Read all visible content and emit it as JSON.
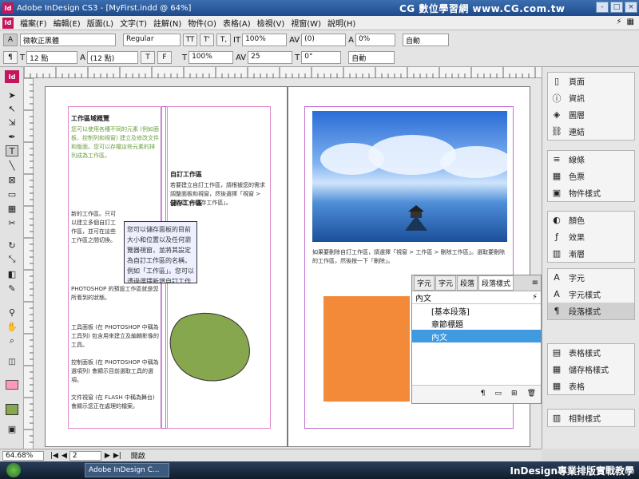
{
  "titlebar": {
    "title": "Adobe InDesign CS3 - [MyFirst.indd @ 64%]",
    "logo": "Id",
    "watermark": "CG 數位學習網 www.CG.com.tw",
    "controls": [
      "-",
      "□",
      "×"
    ]
  },
  "menubar": {
    "logo": "Id",
    "items": [
      "檔案(F)",
      "編輯(E)",
      "版面(L)",
      "文字(T)",
      "註解(N)",
      "物件(O)",
      "表格(A)",
      "檢視(V)",
      "視窗(W)",
      "說明(H)"
    ]
  },
  "control_panel": {
    "row1": {
      "font_family": "微軟正黑體",
      "font_style": "Regular",
      "buttons": [
        "TT",
        "T'",
        "T,",
        "T",
        "Tr",
        "T"
      ],
      "vertical_scale": "100%",
      "kerning": "(0)",
      "baseline_shift": "0%",
      "language": "自動"
    },
    "row2": {
      "font_size": "12 點",
      "leading": "(12 點)",
      "buttons": [
        "T",
        "F",
        "T"
      ],
      "horizontal_scale": "100%",
      "tracking": "25",
      "skew": "0°",
      "rotation": "自動"
    }
  },
  "toolbar": {
    "logo": "Id",
    "tools": [
      "selection",
      "direct-selection",
      "position",
      "pen",
      "type",
      "line",
      "frame",
      "rectangle",
      "table",
      "scissors",
      "rotate",
      "scale",
      "gradient",
      "note",
      "eyedropper",
      "hand",
      "zoom",
      "fill-stroke",
      "apply-color",
      "view-mode"
    ]
  },
  "left_page": {
    "heading": "工作區域概覽",
    "paragraphs": [
      "您可以使用各種不同的元素 (例如面板、控制列和視窗) 建立及修改文件和版面。您可以存檔這些元素的排列成為工作區。",
      "新的工作區。只可以建立多個自訂工作區，並可在這些工作區之間切換。",
      "自訂工作區",
      "若要建立自訂工作區，請根據您的需求調整面板和視窗，然後選擇「視窗 > 工作區 > 儲存工作區」。",
      "儲存工作區",
      "PHOTOSHOP 的預設工作區就是您所看到的狀態。",
      "工具面板 (在 PHOTOSHOP 中稱為工具列) 包含用來建立及編輯影像的工具。",
      "控制面板 (在 PHOTOSHOP 中稱為選項列) 會顯示目前選取工具的選項。",
      "文件視窗 (在 FLASH 中稱為舞台) 會顯示您正在處理的檔案。"
    ],
    "callout": "您可以儲存面板的目前大小和位置以及任何瀏覽器視窗，並將其設定為自訂工作區的名稱，例如「工作區」。您可以透過選擇新增自訂工作區，編輯名稱。"
  },
  "right_page": {
    "caption": "如果要刪除自訂工作區，請選擇「視窗 > 工作區 > 刪除工作區」。選取要刪除的工作區，然後按一下「刪除」。"
  },
  "docked_panels": {
    "group1": [
      {
        "icon": "page-icon",
        "label": "頁面"
      },
      {
        "icon": "info-icon",
        "label": "資訊"
      },
      {
        "icon": "layers-icon",
        "label": "圖層"
      },
      {
        "icon": "link-icon",
        "label": "連結"
      }
    ],
    "group2": [
      {
        "icon": "stroke-icon",
        "label": "線條"
      },
      {
        "icon": "swatch-icon",
        "label": "色票"
      },
      {
        "icon": "object-style-icon",
        "label": "物件樣式"
      }
    ],
    "group3": [
      {
        "icon": "color-icon",
        "label": "顏色"
      },
      {
        "icon": "effects-icon",
        "label": "效果"
      },
      {
        "icon": "gradient-icon",
        "label": "漸層"
      }
    ],
    "group4": [
      {
        "icon": "character-icon",
        "label": "字元"
      },
      {
        "icon": "character-style-icon",
        "label": "字元樣式"
      },
      {
        "icon": "paragraph-style-icon",
        "label": "段落樣式"
      }
    ],
    "group5": [
      {
        "icon": "table-style-icon",
        "label": "表格樣式"
      },
      {
        "icon": "cell-style-icon",
        "label": "儲存格樣式"
      },
      {
        "icon": "table-icon",
        "label": "表格"
      }
    ],
    "group6": [
      {
        "icon": "align-style-icon",
        "label": "相對樣式"
      }
    ]
  },
  "floating_panel": {
    "tabs": [
      "字元",
      "字元",
      "段落",
      "段落樣式"
    ],
    "header": "內文",
    "items": [
      "[基本段落]",
      "章節標題",
      "內文"
    ],
    "selected_index": 2
  },
  "statusbar": {
    "zoom": "64.68%",
    "page": "2",
    "status": "開啟"
  },
  "taskbar": {
    "task": "Adobe InDesign C...",
    "brand": "InDesign專業排版實戰教學"
  },
  "colors": {
    "accent": "#3f9ae0",
    "orange": "#f28a3a",
    "green_blob": "#86a74e",
    "guide": "#c06fcf"
  }
}
